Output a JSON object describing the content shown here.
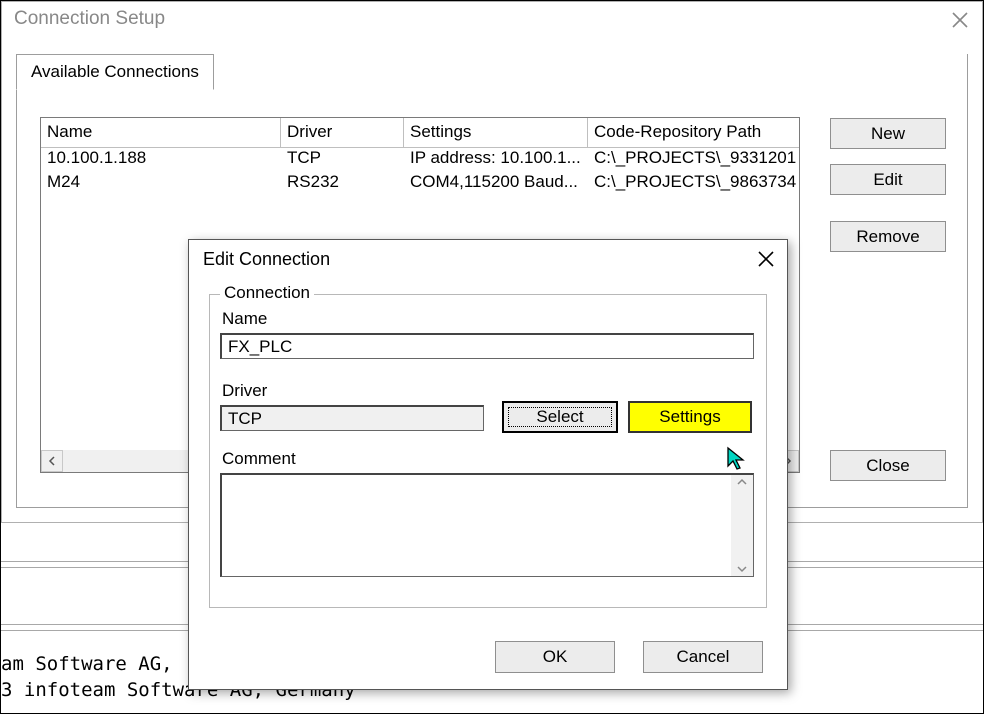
{
  "parent": {
    "title": "Connection Setup",
    "tab": "Available Connections",
    "columns": {
      "name": "Name",
      "driver": "Driver",
      "settings": "Settings",
      "path": "Code-Repository Path"
    },
    "rows": [
      {
        "name": "10.100.1.188",
        "driver": "TCP",
        "settings": "IP address: 10.100.1...",
        "path": "C:\\_PROJECTS\\_9331201"
      },
      {
        "name": "M24",
        "driver": "RS232",
        "settings": "COM4,115200 Baud...",
        "path": "C:\\_PROJECTS\\_9863734"
      }
    ],
    "buttons": {
      "new": "New",
      "edit": "Edit",
      "remove": "Remove",
      "close": "Close"
    }
  },
  "modal": {
    "title": "Edit Connection",
    "group": "Connection",
    "labels": {
      "name": "Name",
      "driver": "Driver",
      "comment": "Comment"
    },
    "name_value": "FX_PLC",
    "driver_value": "TCP",
    "comment_value": "",
    "buttons": {
      "select": "Select",
      "settings": "Settings",
      "ok": "OK",
      "cancel": "Cancel"
    }
  },
  "footer": {
    "line1": "am Software AG,",
    "line2": "3 infoteam Software AG, Germany"
  }
}
